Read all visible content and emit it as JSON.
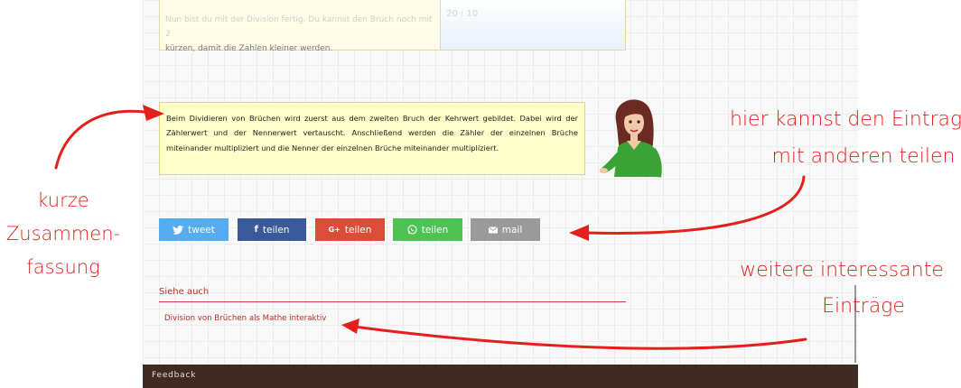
{
  "previous_box": {
    "text_faded": "Nun bist du mit der Division fertig. Du kannst den Bruch noch mit 2",
    "text": "kürzen, damit die Zahlen kleiner werden.",
    "formula_faded": "20 : 10"
  },
  "summary": {
    "text": "Beim Dividieren von Brüchen wird zuerst aus dem zweiten Bruch der Kehrwert gebildet. Dabei wird der Zählerwert und der Nennerwert vertauscht. Anschließend werden die Zähler der einzelnen Brüche miteinander multipliziert und die Nenner der einzelnen Brüche miteinander multipliziert."
  },
  "share": {
    "tweet": {
      "icon": "twitter-bird",
      "label": "tweet",
      "color": "#55acee"
    },
    "facebook": {
      "icon": "f",
      "label": "teilen",
      "color": "#3b5998"
    },
    "googleplus": {
      "icon": "G+",
      "label": "teilen",
      "color": "#dd4b39"
    },
    "whatsapp": {
      "icon": "whatsapp",
      "label": "teilen",
      "color": "#4ec255"
    },
    "mail": {
      "icon": "envelope",
      "label": "mail",
      "color": "#9a9a9a"
    }
  },
  "see_also": {
    "title": "Siehe auch",
    "links": [
      "Division von Brüchen als Mathe interaktiv"
    ]
  },
  "footer": {
    "label": "Feedback"
  },
  "annotations": {
    "left": [
      "kurze",
      "Zusammen-",
      "fassung"
    ],
    "share": [
      "hier kannst den Eintrag",
      "mit anderen teilen"
    ],
    "more": [
      "weitere interessante",
      "Einträge"
    ]
  }
}
